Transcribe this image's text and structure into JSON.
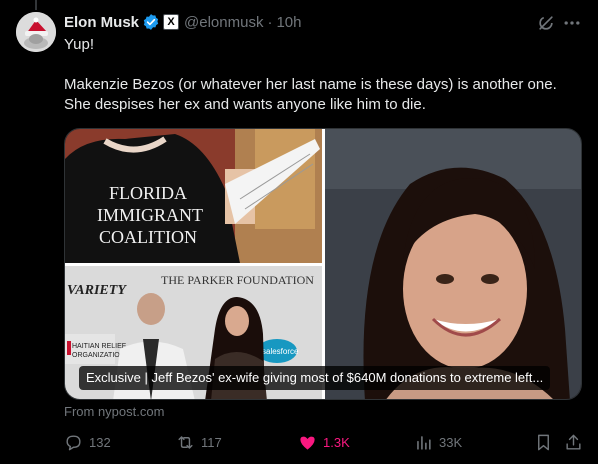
{
  "author": {
    "name": "Elon Musk",
    "handle": "@elonmusk",
    "separator": "·",
    "time": "10h",
    "affiliate_badge": "X",
    "verified_color": "#1d9bf0"
  },
  "post": {
    "line1": "Yup!",
    "line2": "Makenzie Bezos (or whatever her last name is these days) is another one.",
    "line3": "She despises her ex and wants anyone like him to die."
  },
  "card": {
    "image_texts": {
      "shirt_line1": "FLORIDA",
      "shirt_line2": "IMMIGRANT",
      "shirt_line3": "COALITION",
      "foundation": "THE PARKER FOUNDATION",
      "variety": "VARIETY",
      "haitian_line1": "HAITIAN RELIEF",
      "haitian_line2": "ORGANIZATION",
      "salesforce": "salesforce"
    },
    "caption": "Exclusive | Jeff Bezos' ex-wife giving most of $640M donations to extreme left...",
    "source": "From nypost.com"
  },
  "actions": {
    "replies": "132",
    "reposts": "117",
    "likes": "1.3K",
    "views": "33K",
    "like_color": "#f91880",
    "muted_color": "#71767b"
  },
  "icons": [
    "verified-icon",
    "x-affiliate-icon",
    "grok-icon",
    "more-icon",
    "reply-icon",
    "repost-icon",
    "heart-icon",
    "views-icon",
    "bookmark-icon",
    "share-icon"
  ]
}
